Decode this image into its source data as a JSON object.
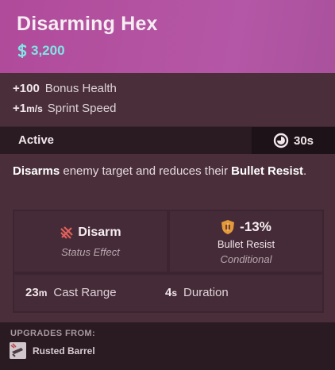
{
  "item": {
    "name": "Disarming Hex",
    "cost": "3,200",
    "colors": {
      "header": "#b352a0",
      "cost": "#7fe6e6",
      "panel": "#4a2f3b"
    }
  },
  "stats": [
    {
      "value": "+100",
      "unit": "",
      "label": "Bonus Health"
    },
    {
      "value": "+1",
      "unit": "m/s",
      "label": "Sprint Speed"
    }
  ],
  "active": {
    "label": "Active",
    "cooldown": "30s",
    "cooldown_icon": "cooldown-clock-icon"
  },
  "description": {
    "bold1": "Disarms",
    "text1": " enemy target and reduces their ",
    "bold2": "Bullet Resist",
    "text2": "."
  },
  "effects": {
    "disarm": {
      "name": "Disarm",
      "sub": "Status Effect",
      "icon": "disarm-icon"
    },
    "resist": {
      "value": "-13%",
      "label": "Bullet Resist",
      "sub": "Conditional",
      "icon": "bullet-shield-icon"
    },
    "range": {
      "value": "23",
      "unit": "m",
      "label": "Cast Range"
    },
    "duration": {
      "value": "4",
      "unit": "s",
      "label": "Duration"
    }
  },
  "upgrades": {
    "title": "UPGRADES FROM:",
    "items": [
      {
        "name": "Rusted Barrel",
        "icon": "rusted-barrel-icon"
      }
    ]
  }
}
